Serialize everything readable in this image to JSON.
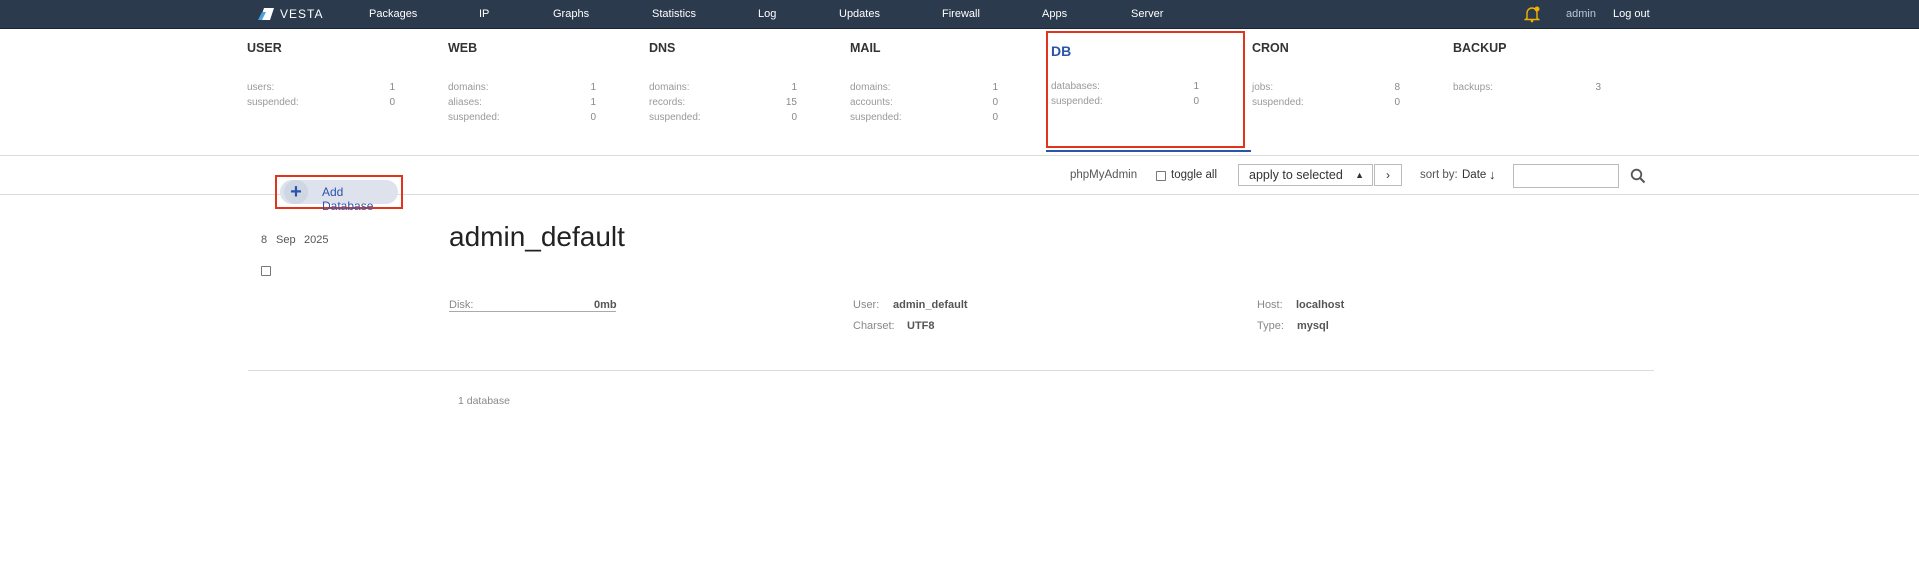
{
  "nav": {
    "logo": "VESTA",
    "items": [
      "Packages",
      "IP",
      "Graphs",
      "Statistics",
      "Log",
      "Updates",
      "Firewall",
      "Apps",
      "Server"
    ],
    "user": "admin",
    "logout": "Log out"
  },
  "stats": [
    {
      "title": "USER",
      "rows": [
        {
          "label": "users:",
          "value": "1"
        },
        {
          "label": "suspended:",
          "value": "0"
        }
      ]
    },
    {
      "title": "WEB",
      "rows": [
        {
          "label": "domains:",
          "value": "1"
        },
        {
          "label": "aliases:",
          "value": "1"
        },
        {
          "label": "suspended:",
          "value": "0"
        }
      ]
    },
    {
      "title": "DNS",
      "rows": [
        {
          "label": "domains:",
          "value": "1"
        },
        {
          "label": "records:",
          "value": "15"
        },
        {
          "label": "suspended:",
          "value": "0"
        }
      ]
    },
    {
      "title": "MAIL",
      "rows": [
        {
          "label": "domains:",
          "value": "1"
        },
        {
          "label": "accounts:",
          "value": "0"
        },
        {
          "label": "suspended:",
          "value": "0"
        }
      ]
    },
    {
      "title": "DB",
      "rows": [
        {
          "label": "databases:",
          "value": "1"
        },
        {
          "label": "suspended:",
          "value": "0"
        }
      ]
    },
    {
      "title": "CRON",
      "rows": [
        {
          "label": "jobs:",
          "value": "8"
        },
        {
          "label": "suspended:",
          "value": "0"
        }
      ]
    },
    {
      "title": "BACKUP",
      "rows": [
        {
          "label": "backups:",
          "value": "3"
        }
      ]
    }
  ],
  "toolbar": {
    "add_label": "Add Database",
    "phpmyadmin": "phpMyAdmin",
    "toggle_all": "toggle all",
    "apply_selected": "apply to selected",
    "sort_label": "sort by:",
    "sort_value": "Date",
    "sort_arrow": "↓",
    "search_value": ""
  },
  "row": {
    "day": "8",
    "month": "Sep",
    "year": "2025",
    "name": "admin_default",
    "disk_label": "Disk:",
    "disk_value": "0mb",
    "user_label": "User:",
    "user_value": "admin_default",
    "charset_label": "Charset:",
    "charset_value": "UTF8",
    "host_label": "Host:",
    "host_value": "localhost",
    "type_label": "Type:",
    "type_value": "mysql"
  },
  "footer": {
    "count": "1 database"
  },
  "colors": {
    "topbar": "#2b3a4d",
    "accent": "#2c54ac",
    "highlight": "#e0351b",
    "bell": "#f0b400"
  }
}
